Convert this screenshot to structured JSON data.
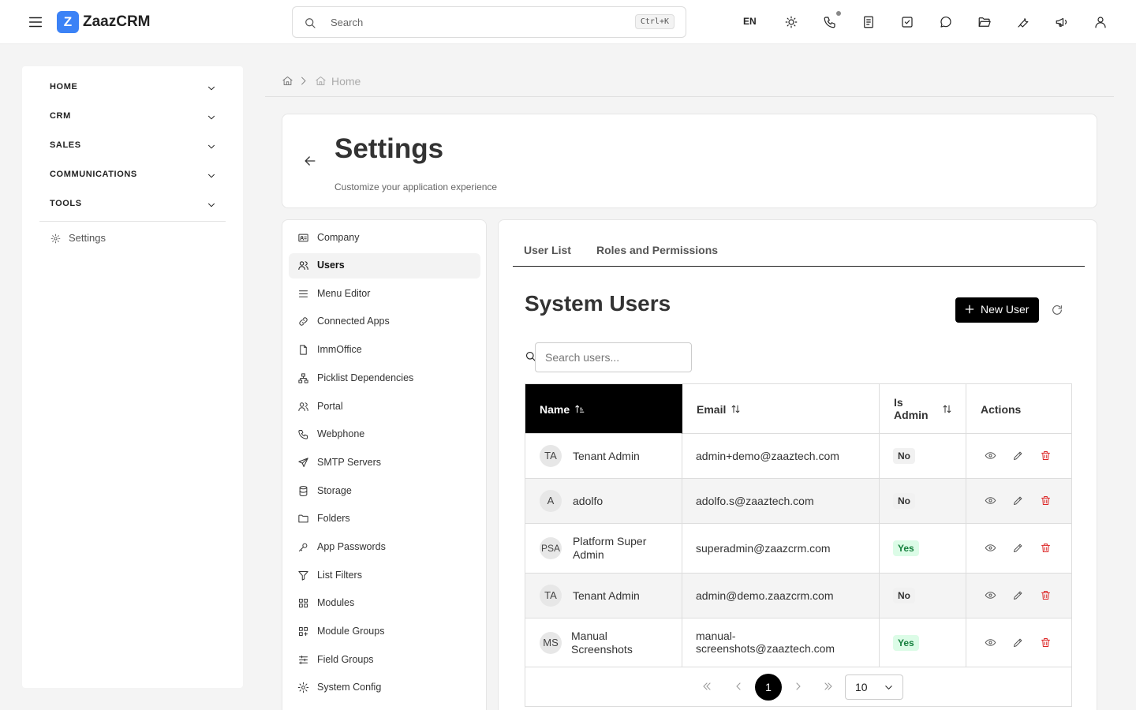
{
  "app": {
    "name": "ZaazCRM",
    "logo_letter": "Z",
    "brand_color": "#3b82f6"
  },
  "topbar": {
    "search_placeholder": "Search",
    "search_shortcut": "Ctrl+K",
    "language": "EN",
    "icons": [
      "sun-icon",
      "phone-icon",
      "notes-icon",
      "tasks-icon",
      "chat-icon",
      "folder-open-icon",
      "wrench-icon",
      "megaphone-icon",
      "user-icon"
    ]
  },
  "nav": {
    "sections": [
      "HOME",
      "CRM",
      "SALES",
      "COMMUNICATIONS",
      "TOOLS"
    ],
    "settings_label": "Settings"
  },
  "breadcrumb": {
    "current": "Home"
  },
  "header": {
    "title": "Settings",
    "subtitle": "Customize your application experience"
  },
  "settings_menu": {
    "active": "Users",
    "items": [
      "Company",
      "Users",
      "Menu Editor",
      "Connected Apps",
      "ImmOffice",
      "Picklist Dependencies",
      "Portal",
      "Webphone",
      "SMTP Servers",
      "Storage",
      "Folders",
      "App Passwords",
      "List Filters",
      "Modules",
      "Module Groups",
      "Field Groups",
      "System Config"
    ]
  },
  "main": {
    "tabs": [
      "User List",
      "Roles and Permissions"
    ],
    "section_title": "System Users",
    "new_user_label": "New User",
    "search_placeholder": "Search users...",
    "table": {
      "columns": {
        "name": "Name",
        "email": "Email",
        "is_admin": "Is Admin",
        "actions": "Actions"
      },
      "sorted_column": "Name",
      "rows": [
        {
          "initials": "TA",
          "name": "Tenant Admin",
          "email": "admin+demo@zaaztech.com",
          "is_admin": "No"
        },
        {
          "initials": "A",
          "name": "adolfo",
          "email": "adolfo.s@zaaztech.com",
          "is_admin": "No"
        },
        {
          "initials": "PSA",
          "name": "Platform Super Admin",
          "email": "superadmin@zaazcrm.com",
          "is_admin": "Yes"
        },
        {
          "initials": "TA",
          "name": "Tenant Admin",
          "email": "admin@demo.zaazcrm.com",
          "is_admin": "No"
        },
        {
          "initials": "MS",
          "name": "Manual Screenshots",
          "email": "manual-screenshots@zaaztech.com",
          "is_admin": "Yes"
        }
      ]
    },
    "pagination": {
      "current_page": "1",
      "page_size": "10"
    }
  }
}
